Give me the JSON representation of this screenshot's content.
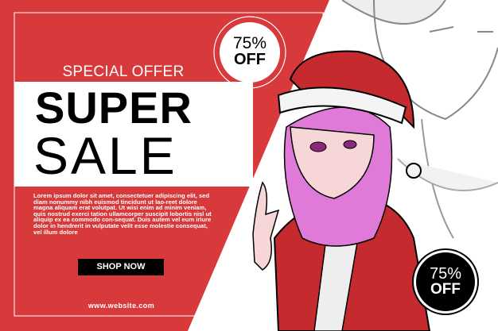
{
  "banner": {
    "special_offer": "SPECIAL OFFER",
    "headline_1": "SUPER",
    "headline_2": "SALE",
    "body_text": "Lorem ipsum dolor sit amet, consectetuer adipiscing elit, sed diam nonummy nibh euismod tincidunt ut lao-reet dolore magna aliquam erat volutpat. Ut wisi enim ad minim veniam, quis nostrud exerci tation ullamcorper suscipit lobortis nisl ut aliquip ex ea commodo con-sequat. Duis autem vel eum iriure dolor in hendrerit in vulputate velit esse molestie consequat, vel illum dolore",
    "cta_label": "SHOP NOW",
    "website": "www.website.com"
  },
  "badges": [
    {
      "percent": "75%",
      "label": "OFF"
    },
    {
      "percent": "75%",
      "label": "OFF"
    }
  ],
  "colors": {
    "brand_red": "#d8393b",
    "black": "#000000",
    "white": "#ffffff",
    "hair": "#e07ad8"
  }
}
